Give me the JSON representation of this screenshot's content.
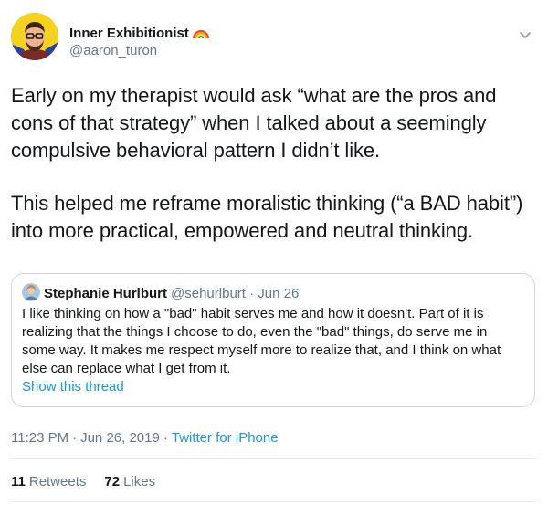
{
  "author": {
    "display_name": "Inner Exhibitionist",
    "handle": "@aaron_turon",
    "avatar_icon": "avatar-illustration-icon",
    "name_emoji": "rainbow-icon"
  },
  "tweet": {
    "paragraphs": [
      "Early on my therapist would ask “what are the pros and\ncons of that strategy” when I talked about a seemingly\ncompulsive behavioral pattern I didn’t like.",
      "This helped me reframe moralistic thinking (“a BAD habit”)\ninto more practical, empowered and neutral thinking."
    ],
    "menu_icon": "chevron-down-icon"
  },
  "quoted_tweet": {
    "display_name": "Stephanie Hurlburt",
    "handle": "@sehurlburt",
    "separator": "·",
    "date": "Jun 26",
    "text": "I like thinking on how a \"bad\" habit serves me and how it doesn't. Part of it is\nrealizing that the things I choose to do, even the \"bad\" things, do serve me in\nsome way. It makes me respect myself more to realize that, and I think on what\nelse can replace what I get from it.",
    "show_thread": "Show this thread"
  },
  "meta": {
    "time": "11:23 PM",
    "separator": "·",
    "date": "Jun 26, 2019",
    "source": "Twitter for iPhone"
  },
  "stats": {
    "retweets_count": "11",
    "retweets_label": "Retweets",
    "likes_count": "72",
    "likes_label": "Likes"
  },
  "colors": {
    "text": "#14171a",
    "secondary": "#657786",
    "link": "#1b95e0",
    "border": "#ccd6dd",
    "avatar_bg": "#f4d21f"
  }
}
